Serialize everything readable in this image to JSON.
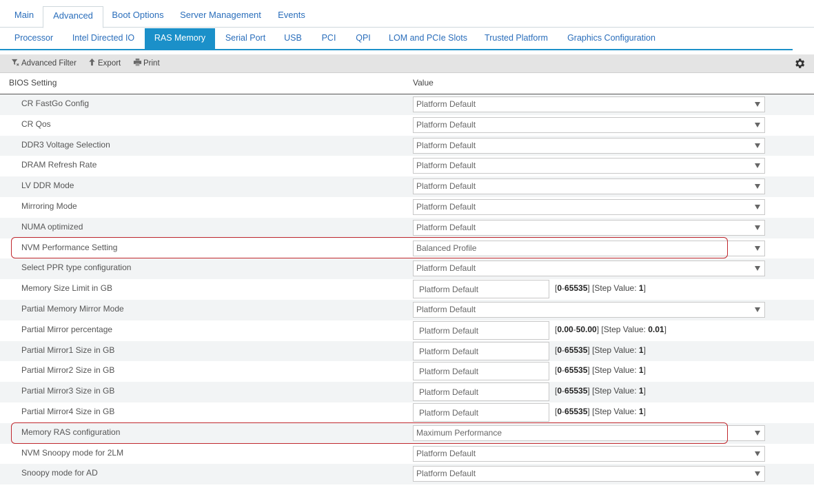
{
  "top_tabs": [
    {
      "label": "Main",
      "active": false
    },
    {
      "label": "Advanced",
      "active": true
    },
    {
      "label": "Boot Options",
      "active": false
    },
    {
      "label": "Server Management",
      "active": false
    },
    {
      "label": "Events",
      "active": false
    }
  ],
  "sub_tabs": [
    {
      "label": "Processor",
      "active": false
    },
    {
      "label": "Intel Directed IO",
      "active": false
    },
    {
      "label": "RAS Memory",
      "active": true
    },
    {
      "label": "Serial Port",
      "active": false
    },
    {
      "label": "USB",
      "active": false
    },
    {
      "label": "PCI",
      "active": false
    },
    {
      "label": "QPI",
      "active": false
    },
    {
      "label": "LOM and PCIe Slots",
      "active": false
    },
    {
      "label": "Trusted Platform",
      "active": false
    },
    {
      "label": "Graphics Configuration",
      "active": false
    }
  ],
  "toolbar": {
    "filter_label": "Advanced Filter",
    "export_label": "Export",
    "print_label": "Print",
    "settings_icon": "gear-icon"
  },
  "table": {
    "col_setting": "BIOS Setting",
    "col_value": "Value",
    "rows": [
      {
        "setting": "CR FastGo Config",
        "type": "select",
        "value": "Platform Default"
      },
      {
        "setting": "CR Qos",
        "type": "select",
        "value": "Platform Default"
      },
      {
        "setting": "DDR3 Voltage Selection",
        "type": "select",
        "value": "Platform Default"
      },
      {
        "setting": "DRAM Refresh Rate",
        "type": "select",
        "value": "Platform Default"
      },
      {
        "setting": "LV DDR Mode",
        "type": "select",
        "value": "Platform Default"
      },
      {
        "setting": "Mirroring Mode",
        "type": "select",
        "value": "Platform Default"
      },
      {
        "setting": "NUMA optimized",
        "type": "select",
        "value": "Platform Default"
      },
      {
        "setting": "NVM Performance Setting",
        "type": "select",
        "value": "Balanced Profile",
        "highlighted": true
      },
      {
        "setting": "Select PPR type configuration",
        "type": "select",
        "value": "Platform Default"
      },
      {
        "setting": "Memory Size Limit in GB",
        "type": "text",
        "value": "Platform Default",
        "range_min": "0",
        "range_max": "65535",
        "step_label": "[Step Value: ",
        "step": "1"
      },
      {
        "setting": "Partial Memory Mirror Mode",
        "type": "select",
        "value": "Platform Default"
      },
      {
        "setting": "Partial Mirror percentage",
        "type": "text",
        "value": "Platform Default",
        "range_min": "0.00",
        "range_max": "50.00",
        "step_label": "[Step Value: ",
        "step": "0.01"
      },
      {
        "setting": "Partial Mirror1 Size in GB",
        "type": "text",
        "value": "Platform Default",
        "range_min": "0",
        "range_max": "65535",
        "step_label": "[Step Value: ",
        "step": "1"
      },
      {
        "setting": "Partial Mirror2 Size in GB",
        "type": "text",
        "value": "Platform Default",
        "range_min": "0",
        "range_max": "65535",
        "step_label": "[Step Value: ",
        "step": "1"
      },
      {
        "setting": "Partial Mirror3 Size in GB",
        "type": "text",
        "value": "Platform Default",
        "range_min": "0",
        "range_max": "65535",
        "step_label": "[Step Value: ",
        "step": "1"
      },
      {
        "setting": "Partial Mirror4 Size in GB",
        "type": "text",
        "value": "Platform Default",
        "range_min": "0",
        "range_max": "65535",
        "step_label": "[Step Value: ",
        "step": "1"
      },
      {
        "setting": "Memory RAS configuration",
        "type": "select",
        "value": "Maximum Performance",
        "highlighted": true
      },
      {
        "setting": "NVM Snoopy mode for 2LM",
        "type": "select",
        "value": "Platform Default"
      },
      {
        "setting": "Snoopy mode for AD",
        "type": "select",
        "value": "Platform Default"
      }
    ]
  },
  "colors": {
    "accent": "#1b90c9",
    "link": "#2a6ebb",
    "highlight_border": "#c0272d",
    "row_alt": "#f2f4f5"
  }
}
